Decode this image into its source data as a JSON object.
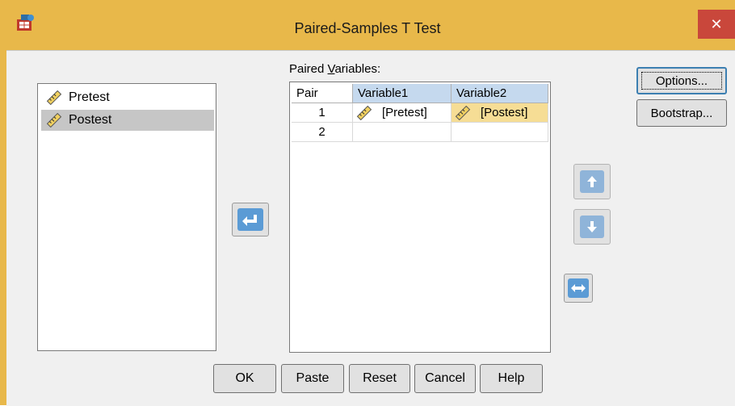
{
  "window": {
    "title": "Paired-Samples T Test",
    "close_glyph": "✕"
  },
  "source_variables": [
    {
      "label": "Pretest",
      "icon": "ruler-scale-icon",
      "selected": false
    },
    {
      "label": "Postest",
      "icon": "ruler-scale-icon",
      "selected": true
    }
  ],
  "paired": {
    "label_prefix": "Paired ",
    "label_mnemonic": "V",
    "label_suffix": "ariables:",
    "columns": [
      "Pair",
      "Variable1",
      "Variable2"
    ],
    "rows": [
      {
        "pair": "1",
        "variable1": "[Pretest]",
        "variable2": "[Postest]"
      },
      {
        "pair": "2",
        "variable1": "",
        "variable2": ""
      }
    ]
  },
  "buttons": {
    "options": "Options...",
    "bootstrap": "Bootstrap...",
    "ok": "OK",
    "paste": "Paste",
    "reset": "Reset",
    "cancel": "Cancel",
    "help": "Help"
  },
  "colors": {
    "titlebar": "#e8b84a",
    "close": "#c9473b",
    "accent_blue": "#5b9bd5",
    "highlight_cell": "#f6dd95"
  }
}
